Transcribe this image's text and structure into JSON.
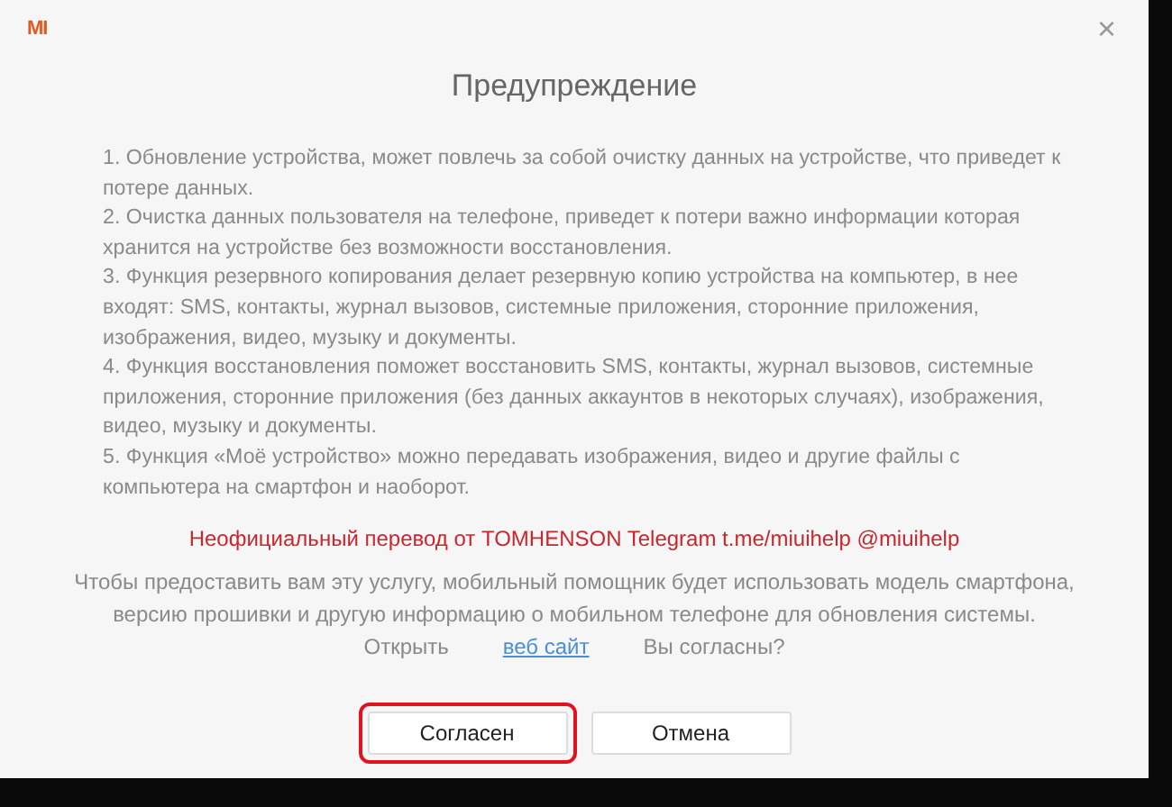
{
  "window": {
    "logo": "MI",
    "close": "×",
    "title": "Предупреждение"
  },
  "warnings": [
    "1. Обновление устройства, может повлечь за собой очистку данных на устройстве, что приведет к потере данных.",
    "2. Очистка данных пользователя на телефоне, приведет к потери важно информации которая хранится на устройстве без возможности восстановления.",
    "3. Функция резервного копирования  делает резервную копию устройства на компьютер, в нее входят: SMS, контакты, журнал вызовов, системные приложения, сторонние приложения, изображения, видео, музыку и документы.",
    "4. Функция восстановления поможет восстановить SMS, контакты, журнал вызовов, системные приложения, сторонние приложения (без данных аккаунтов в некоторых случаях), изображения, видео, музыку и документы.",
    "5. Функция «Моё устройство» можно передавать изображения, видео и другие файлы с компьютера на смартфон и наоборот."
  ],
  "translation_note": "Неофициальный перевод от TOMHENSON Telegram t.me/miuihelp @miuihelp",
  "consent": {
    "text": "Чтобы предоставить вам эту услугу, мобильный помощник будет использовать модель смартфона, версию прошивки и другую информацию о мобильном телефоне для обновления системы.",
    "open_label": "Открыть",
    "link": "веб сайт",
    "question": "Вы согласны?"
  },
  "buttons": [
    {
      "label": "Согласен",
      "highlighted": true
    },
    {
      "label": "Отмена",
      "highlighted": false
    }
  ]
}
